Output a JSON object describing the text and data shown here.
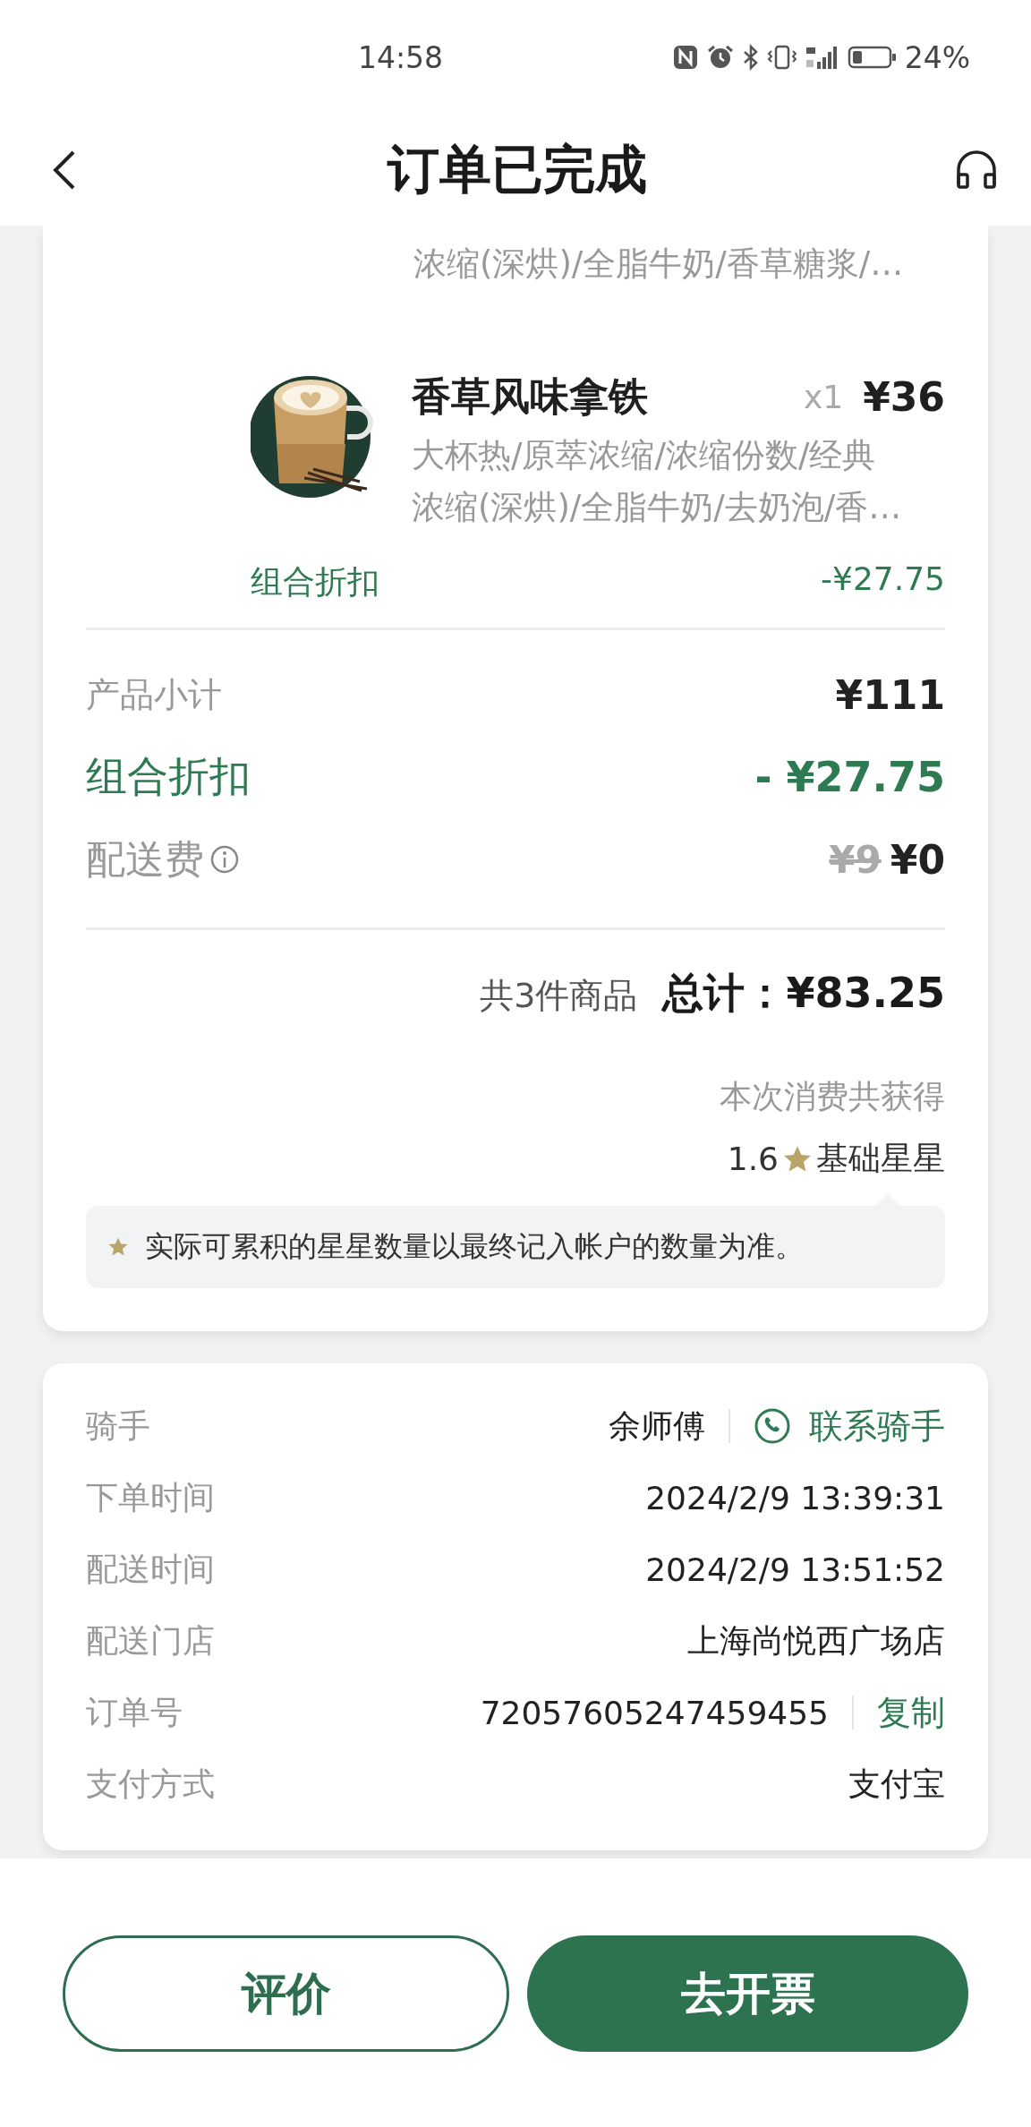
{
  "status_bar": {
    "time": "14:58",
    "battery": "24%"
  },
  "header": {
    "title": "订单已完成"
  },
  "continued_item": {
    "options": "浓缩(深烘)/全脂牛奶/香草糖浆/…"
  },
  "product": {
    "name": "香草风味拿铁",
    "quantity": "x1",
    "price": "¥36",
    "image": {
      "kind": "picture"
    },
    "options": [
      "大杯热/原萃浓缩/浓缩份数/经典",
      "浓缩(深烘)/全脂牛奶/去奶泡/香…"
    ],
    "discount_label": "组合折扣",
    "discount": "-¥27.75"
  },
  "summary": [
    {
      "kind": "subtotal",
      "label": "产品小计",
      "value": "¥111"
    },
    {
      "kind": "discount",
      "label": "组合折扣",
      "value": "- ¥27.75"
    },
    {
      "kind": "delivery",
      "label": "配送费",
      "original": "¥9",
      "value": "¥0"
    }
  ],
  "total": {
    "count": "共3件商品",
    "label": "总计：",
    "amount": "¥83.25"
  },
  "stars": {
    "caption": "本次消费共获得",
    "amount": "1.6",
    "label": "基础星星",
    "note": "实际可累积的星星数量以最终记入帐户的数量为准。"
  },
  "details": [
    {
      "kind": "contact",
      "label": "骑手",
      "value": "余师傅",
      "action": "联系骑手"
    },
    {
      "kind": "plain",
      "label": "下单时间",
      "value": "2024/2/9 13:39:31"
    },
    {
      "kind": "plain",
      "label": "配送时间",
      "value": "2024/2/9 13:51:52"
    },
    {
      "kind": "plain",
      "label": "配送门店",
      "value": "上海尚悦西广场店"
    },
    {
      "kind": "copy",
      "label": "订单号",
      "value": "72057605247459455",
      "action": "复制"
    },
    {
      "kind": "plain",
      "label": "支付方式",
      "value": "支付宝"
    }
  ],
  "buttons": [
    {
      "kind": "outline",
      "label": "评价"
    },
    {
      "kind": "filled",
      "label": "去开票"
    }
  ]
}
